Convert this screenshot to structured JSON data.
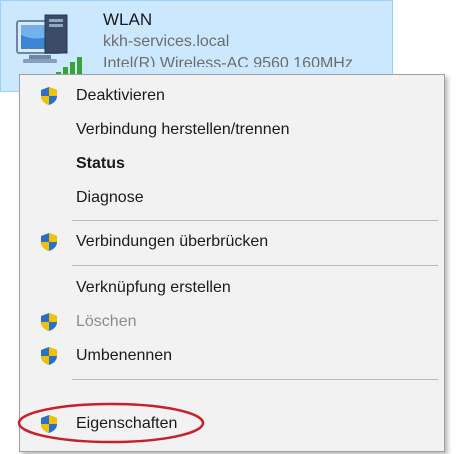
{
  "adapter": {
    "name": "WLAN",
    "network": "kkh-services.local",
    "device": "Intel(R) Wireless-AC 9560 160MHz",
    "icon": "network-adapter-icon"
  },
  "menu": {
    "items": [
      {
        "label": "Deaktivieren",
        "shield": true,
        "bold": false,
        "disabled": false
      },
      {
        "label": "Verbindung herstellen/trennen",
        "shield": false,
        "bold": false,
        "disabled": false
      },
      {
        "label": "Status",
        "shield": false,
        "bold": true,
        "disabled": false
      },
      {
        "label": "Diagnose",
        "shield": false,
        "bold": false,
        "disabled": false
      },
      {
        "label": "Verbindungen überbrücken",
        "shield": true,
        "bold": false,
        "disabled": false
      },
      {
        "label": "Verknüpfung erstellen",
        "shield": false,
        "bold": false,
        "disabled": false
      },
      {
        "label": "Löschen",
        "shield": true,
        "bold": false,
        "disabled": true
      },
      {
        "label": "Umbenennen",
        "shield": true,
        "bold": false,
        "disabled": false
      },
      {
        "label": "Eigenschaften",
        "shield": true,
        "bold": false,
        "disabled": false,
        "highlighted": true
      }
    ]
  },
  "colors": {
    "tile_background": "#cce8ff",
    "menu_background": "#f2f2f2",
    "highlight_ring": "#c8202a",
    "shield_blue": "#2a6fc9",
    "shield_yellow": "#f2c200"
  }
}
